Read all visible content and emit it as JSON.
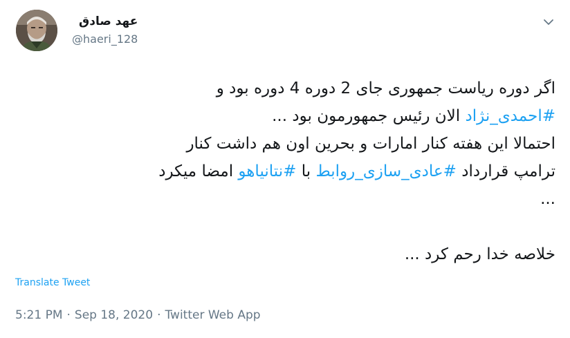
{
  "author": {
    "display_name": "عهد صادق",
    "handle": "@haeri_128"
  },
  "menu": {
    "caret_icon": "chevron-down-icon"
  },
  "tweet": {
    "line1": "اگر دوره ریاست جمهوری جای 2 دوره 4 دوره بود و",
    "line2_hashtag": "#احمدی_نژاد",
    "line2_rest": " الان رئیس جمهورمون بود ...",
    "line3": "احتمالا این هفته کنار امارات و بحرین اون هم داشت کنار",
    "line4_start": "ترامپ قرارداد ",
    "line4_hashtag1": "#عادی_سازی_روابط",
    "line4_mid": " با ",
    "line4_hashtag2": "#نتانیاهو",
    "line4_end": " امضا میکرد",
    "line5": "...",
    "line6": "خلاصه خدا رحم کرد ..."
  },
  "translate_label": "Translate Tweet",
  "meta": {
    "time": "5:21 PM",
    "separator": "·",
    "date": "Sep 18, 2020",
    "source": "Twitter Web App"
  },
  "colors": {
    "link": "#1da1f2",
    "secondary_text": "#657786",
    "primary_text": "#14171a"
  }
}
